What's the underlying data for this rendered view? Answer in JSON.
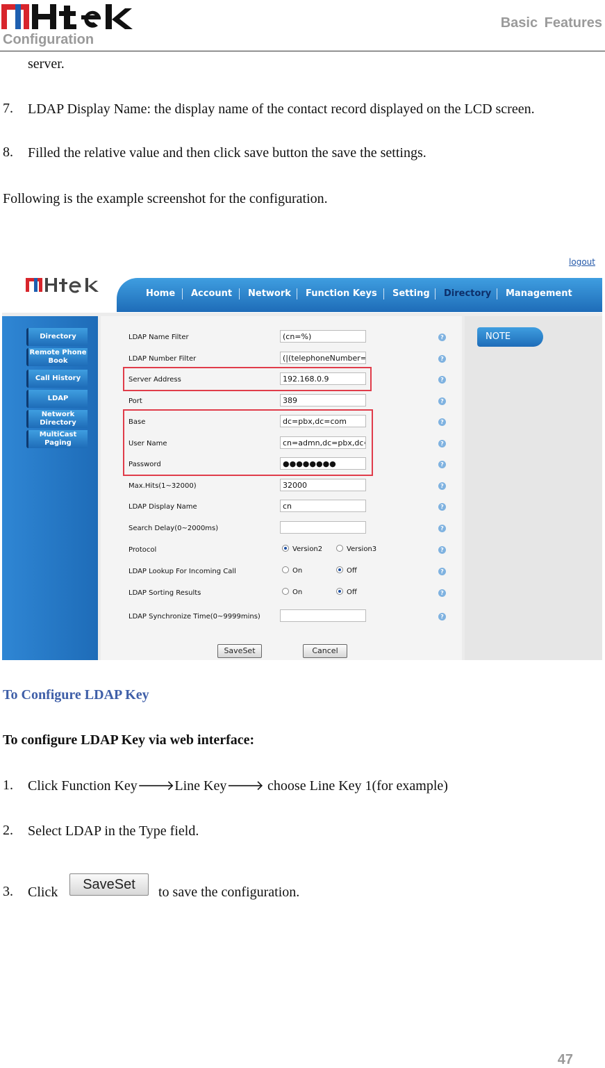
{
  "header": {
    "left": "Configuration",
    "right": "Basic Features"
  },
  "body": {
    "line0": "server.",
    "item7": {
      "num": "7.",
      "text": "LDAP Display Name: the display name of the contact record displayed on the LCD screen."
    },
    "item8": {
      "num": "8.",
      "text": "Filled the relative value and then click save button the save the settings."
    },
    "following": "Following is the example screenshot for the configuration.",
    "heading1": "To Configure LDAP Key",
    "heading2": "To configure LDAP Key via web interface:",
    "step1": {
      "num": "1.",
      "a": "Click Function Key",
      "arrow1": "🡒",
      "b": "Line Key",
      "arrow2": "🡒",
      "c": " choose Line Key 1(for example)"
    },
    "step2": {
      "num": "2.",
      "text": "Select LDAP in the Type field."
    },
    "step3": {
      "num": "3.",
      "pre": "Click",
      "button": "SaveSet",
      "post": "to save the configuration."
    }
  },
  "page_number": "47",
  "screenshot": {
    "logout": "logout",
    "nav": [
      "Home",
      "Account",
      "Network",
      "Function Keys",
      "Setting",
      "Directory",
      "Management"
    ],
    "sidebar": [
      "Directory",
      "Remote Phone Book",
      "Call History",
      "LDAP",
      "Network Directory",
      "MultiCast Paging"
    ],
    "note": "NOTE",
    "fields": [
      {
        "label": "LDAP Name Filter",
        "value": "(cn=%)"
      },
      {
        "label": "LDAP Number Filter",
        "value": "(|(telephoneNumber=%"
      },
      {
        "label": "Server Address",
        "value": "192.168.0.9"
      },
      {
        "label": "Port",
        "value": "389"
      },
      {
        "label": "Base",
        "value": "dc=pbx,dc=com"
      },
      {
        "label": "User Name",
        "value": "cn=admn,dc=pbx,dc=com"
      },
      {
        "label": "Password",
        "value": "●●●●●●●●"
      },
      {
        "label": "Max.Hits(1~32000)",
        "value": "32000"
      },
      {
        "label": "LDAP Display Name",
        "value": "cn"
      },
      {
        "label": "Search Delay(0~2000ms)",
        "value": ""
      },
      {
        "label": "Protocol",
        "options": [
          "Version2",
          "Version3"
        ]
      },
      {
        "label": "LDAP Lookup For Incoming Call",
        "options": [
          "On",
          "Off"
        ]
      },
      {
        "label": "LDAP Sorting Results",
        "options": [
          "On",
          "Off"
        ]
      },
      {
        "label": "LDAP Synchronize Time(0~9999mins)",
        "value": ""
      }
    ],
    "save_button": "SaveSet",
    "cancel_button": "Cancel",
    "help_glyph": "?"
  },
  "colors": {
    "accent_blue": "#1e6cb8",
    "heading_blue": "#3f5fa8",
    "logo_red": "#d8252c",
    "highlight_red": "#e03c4a"
  }
}
